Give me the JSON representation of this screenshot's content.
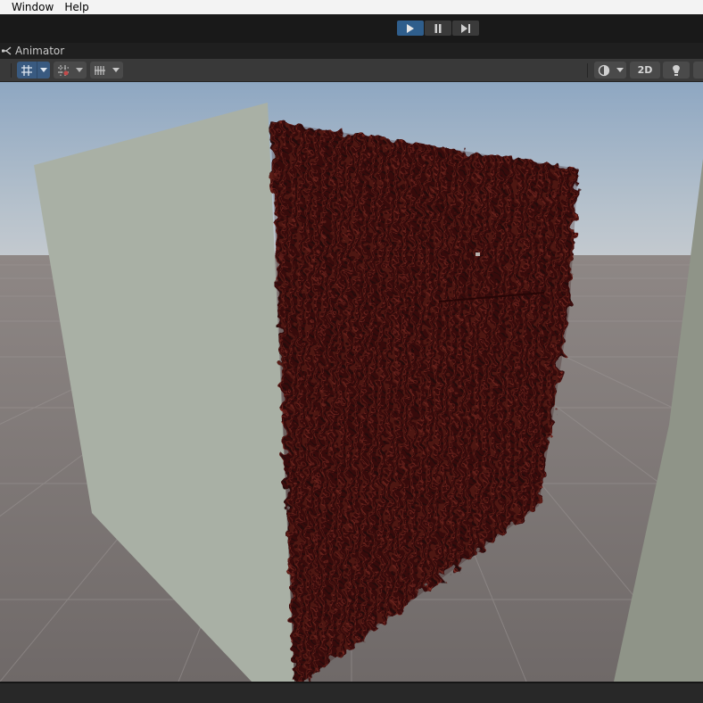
{
  "menubar": {
    "items": [
      {
        "label": "Window"
      },
      {
        "label": "Help"
      }
    ]
  },
  "playmode": {
    "buttons": [
      {
        "icon": "play-icon",
        "active": true
      },
      {
        "icon": "pause-icon",
        "active": false
      },
      {
        "icon": "step-icon",
        "active": false
      }
    ]
  },
  "tab": {
    "label": "Animator",
    "icon": "animator-icon"
  },
  "scene_toolbar": {
    "left_tools": [
      "transform-tools-icon",
      "snap-icon",
      "grid-icon"
    ],
    "right_tools": {
      "shading_icon": "shading-mode-icon",
      "mode_2d_label": "2D",
      "lighting_icon": "lighting-icon"
    }
  },
  "colors": {
    "accent": "#2f5e8c",
    "sky_top": "#8ea7c2",
    "sky_horizon": "#c3c9cf",
    "ground": "#7b7574",
    "wall_light": "#a9b0a5",
    "wall_dark": "#8f9488",
    "dissolve_red": "#4a1212"
  }
}
